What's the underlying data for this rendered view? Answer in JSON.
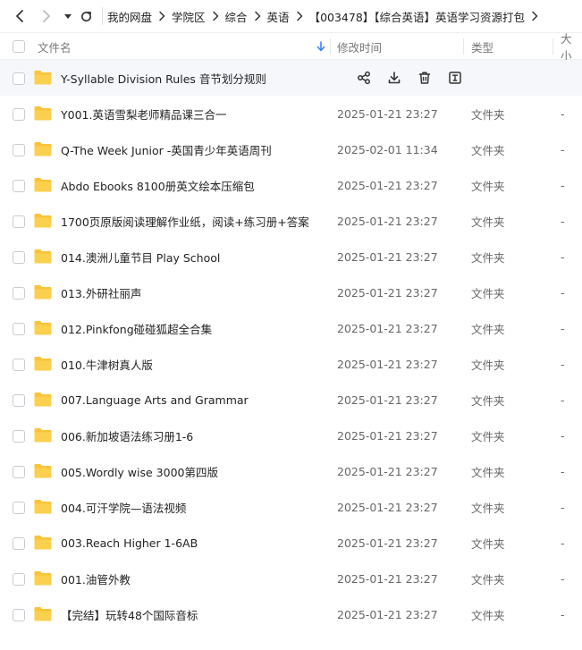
{
  "nav": {
    "back_icon": "chevron-left-icon",
    "forward_icon": "chevron-right-icon",
    "history_icon": "caret-down-icon",
    "refresh_icon": "refresh-icon"
  },
  "breadcrumb": [
    "我的网盘",
    "学院区",
    "综合",
    "英语",
    "【003478】【综合英语】英语学习资源打包"
  ],
  "columns": {
    "name": "文件名",
    "modified": "修改时间",
    "type": "类型",
    "size": "大小",
    "sort_icon": "arrow-down-icon"
  },
  "hover_actions": [
    "share-icon",
    "download-icon",
    "delete-icon",
    "rename-icon"
  ],
  "colors": {
    "accent": "#3b82f6",
    "folder": "#f9c43a",
    "hover": "#f5f7fa"
  },
  "files": [
    {
      "name": "Y-Syllable Division Rules 音节划分规则",
      "modified": "",
      "type": "",
      "size": "",
      "hover": true
    },
    {
      "name": "Y001.英语雪梨老师精品课三合一",
      "modified": "2025-01-21 23:27",
      "type": "文件夹",
      "size": "-"
    },
    {
      "name": "Q-The Week Junior -英国青少年英语周刊",
      "modified": "2025-02-01 11:34",
      "type": "文件夹",
      "size": "-"
    },
    {
      "name": "Abdo Ebooks 8100册英文绘本压缩包",
      "modified": "2025-01-21 23:27",
      "type": "文件夹",
      "size": "-"
    },
    {
      "name": "1700页原版阅读理解作业纸，阅读+练习册+答案",
      "modified": "2025-01-21 23:27",
      "type": "文件夹",
      "size": "-"
    },
    {
      "name": "014.澳洲儿童节目 Play School",
      "modified": "2025-01-21 23:27",
      "type": "文件夹",
      "size": "-"
    },
    {
      "name": "013.外研社丽声",
      "modified": "2025-01-21 23:27",
      "type": "文件夹",
      "size": "-"
    },
    {
      "name": "012.Pinkfong碰碰狐超全合集",
      "modified": "2025-01-21 23:27",
      "type": "文件夹",
      "size": "-"
    },
    {
      "name": "010.牛津树真人版",
      "modified": "2025-01-21 23:27",
      "type": "文件夹",
      "size": "-"
    },
    {
      "name": "007.Language Arts and Grammar",
      "modified": "2025-01-21 23:27",
      "type": "文件夹",
      "size": "-"
    },
    {
      "name": "006.新加坡语法练习册1-6",
      "modified": "2025-01-21 23:27",
      "type": "文件夹",
      "size": "-"
    },
    {
      "name": "005.Wordly wise 3000第四版",
      "modified": "2025-01-21 23:27",
      "type": "文件夹",
      "size": "-"
    },
    {
      "name": "004.可汗学院—语法视频",
      "modified": "2025-01-21 23:27",
      "type": "文件夹",
      "size": "-"
    },
    {
      "name": "003.Reach Higher 1-6AB",
      "modified": "2025-01-21 23:27",
      "type": "文件夹",
      "size": "-"
    },
    {
      "name": "001.油管外教",
      "modified": "2025-01-21 23:27",
      "type": "文件夹",
      "size": "-"
    },
    {
      "name": "【完结】玩转48个国际音标",
      "modified": "2025-01-21 23:27",
      "type": "文件夹",
      "size": "-"
    }
  ]
}
